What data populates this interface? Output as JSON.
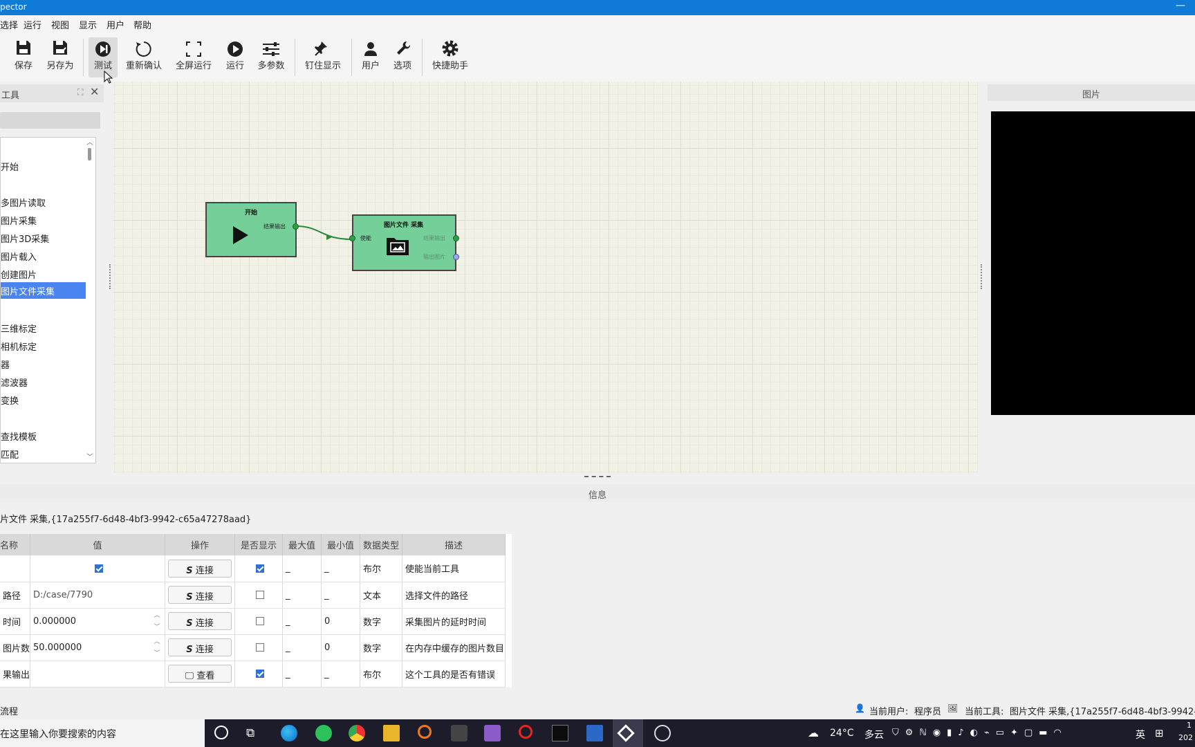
{
  "window": {
    "title": "pector",
    "minimize": "—"
  },
  "menu": [
    "选择",
    "运行",
    "视图",
    "显示",
    "用户",
    "帮助"
  ],
  "toolbar": {
    "save": "保存",
    "save_as": "另存为",
    "test": "测试",
    "reconfirm": "重新确认",
    "fullscreen_run": "全屏运行",
    "run": "运行",
    "multi_params": "多参数",
    "pin_display": "钉住显示",
    "user": "用户",
    "options": "选项",
    "quick_helper": "快捷助手"
  },
  "tool_panel": {
    "title": "工具",
    "items": [
      "开始",
      "多图片读取",
      "图片采集",
      "图片3D采集",
      "图片载入",
      "创建图片",
      "图片文件采集",
      "三维标定",
      "相机标定",
      "器",
      "滤波器",
      "变换",
      "查找模板",
      "匹配"
    ],
    "selected": "图片文件采集"
  },
  "flow": {
    "start_node": {
      "title": "开始",
      "out_port": "结果输出"
    },
    "file_node": {
      "title": "图片文件 采集",
      "in_port": "使能",
      "out_port1": "结果输出",
      "out_port2": "输出图片"
    }
  },
  "image_panel": {
    "title": "图片"
  },
  "info": {
    "title": "信息",
    "tool_id": "片文件 采集,{17a255f7-6d48-4bf3-9942-c65a47278aad}",
    "columns": [
      "名称",
      "值",
      "操作",
      "是否显示",
      "最大值",
      "最小值",
      "数据类型",
      "描述"
    ],
    "rows": [
      {
        "name": "",
        "value": "",
        "checked_value": true,
        "action": "连接",
        "show": true,
        "max": "_",
        "min": "_",
        "type": "布尔",
        "desc": "使能当前工具"
      },
      {
        "name": "路径",
        "value": "D:/case/7790",
        "action": "连接",
        "show": false,
        "max": "_",
        "min": "_",
        "type": "文本",
        "desc": "选择文件的路径"
      },
      {
        "name": "时间",
        "value": "0.000000",
        "action": "连接",
        "show": false,
        "max": "_",
        "min": "0",
        "type": "数字",
        "desc": "采集图片的延时时间"
      },
      {
        "name": "图片数",
        "value": "50.000000",
        "action": "连接",
        "show": false,
        "max": "_",
        "min": "0",
        "type": "数字",
        "desc": "在内存中缓存的图片数目"
      },
      {
        "name": "果输出",
        "value": "",
        "action": "查看",
        "show": true,
        "max": "_",
        "min": "_",
        "type": "布尔",
        "desc": "这个工具的是否有错误"
      }
    ]
  },
  "status": {
    "left": "流程",
    "user_label": "当前用户:",
    "user_value": "程序员",
    "tool_label": "当前工具:",
    "tool_value": "图片文件 采集,{17a255f7-6d48-4bf3-9942-"
  },
  "taskbar": {
    "search_placeholder": "在这里输入你要搜索的内容",
    "weather_temp": "24°C",
    "weather_desc": "多云",
    "ime": "英",
    "clock_top": "1",
    "clock_bottom": "202"
  }
}
